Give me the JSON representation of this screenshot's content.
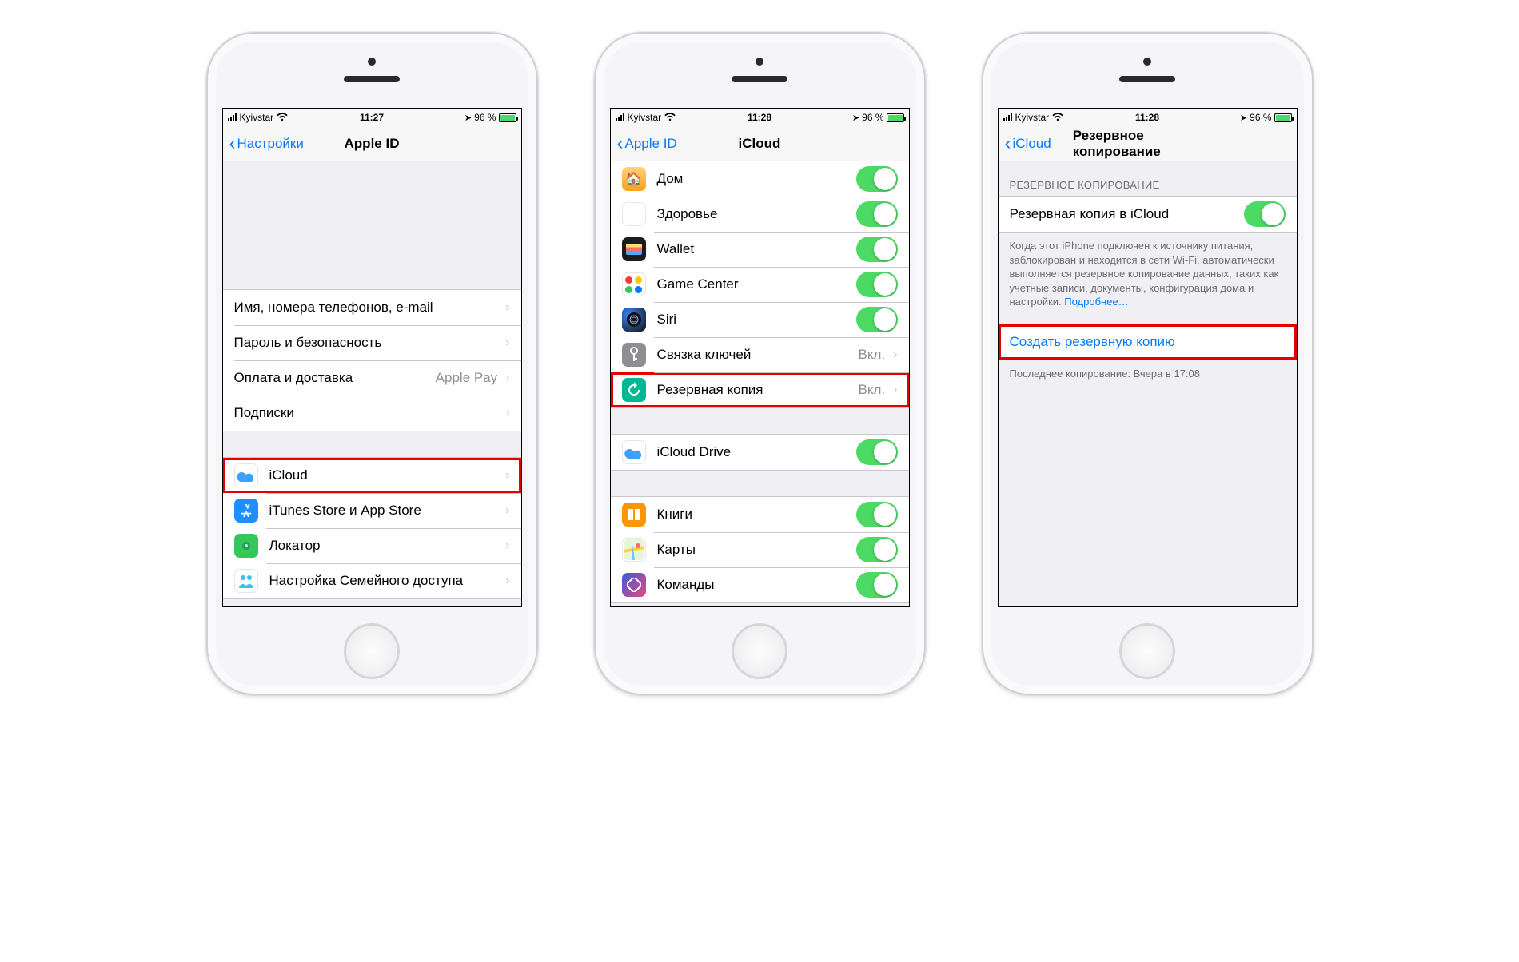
{
  "phone1": {
    "status": {
      "carrier": "Kyivstar",
      "time": "11:27",
      "battery": "96 %"
    },
    "nav": {
      "back": "Настройки",
      "title": "Apple ID"
    },
    "group1": [
      {
        "label": "Имя, номера телефонов, e-mail"
      },
      {
        "label": "Пароль и безопасность"
      },
      {
        "label": "Оплата и доставка",
        "detail": "Apple Pay"
      },
      {
        "label": "Подписки"
      }
    ],
    "group2": [
      {
        "label": "iCloud",
        "highlight": true,
        "icon": "icloud-icon"
      },
      {
        "label": "iTunes Store и App Store",
        "icon": "appstore-icon"
      },
      {
        "label": "Локатор",
        "icon": "findmy-icon"
      },
      {
        "label": "Настройка Семейного доступа",
        "icon": "family-icon"
      }
    ]
  },
  "phone2": {
    "status": {
      "carrier": "Kyivstar",
      "time": "11:28",
      "battery": "96 %"
    },
    "nav": {
      "back": "Apple ID",
      "title": "iCloud"
    },
    "groupA": [
      {
        "label": "Дом",
        "icon": "home-icon",
        "toggle": true
      },
      {
        "label": "Здоровье",
        "icon": "health-icon",
        "toggle": true
      },
      {
        "label": "Wallet",
        "icon": "wallet-icon",
        "toggle": true
      },
      {
        "label": "Game Center",
        "icon": "gamecenter-icon",
        "toggle": true
      },
      {
        "label": "Siri",
        "icon": "siri-icon",
        "toggle": true
      },
      {
        "label": "Связка ключей",
        "icon": "keychain-icon",
        "detail": "Вкл."
      },
      {
        "label": "Резервная копия",
        "icon": "backup-icon",
        "detail": "Вкл.",
        "highlight": true
      }
    ],
    "groupB": [
      {
        "label": "iCloud Drive",
        "icon": "iclouddrive-icon",
        "toggle": true
      }
    ],
    "groupC": [
      {
        "label": "Книги",
        "icon": "books-icon",
        "toggle": true
      },
      {
        "label": "Карты",
        "icon": "maps-icon",
        "toggle": true
      },
      {
        "label": "Команды",
        "icon": "shortcuts-icon",
        "toggle": true
      }
    ]
  },
  "phone3": {
    "status": {
      "carrier": "Kyivstar",
      "time": "11:28",
      "battery": "96 %"
    },
    "nav": {
      "back": "iCloud",
      "title": "Резервное копирование"
    },
    "section_header": "РЕЗЕРВНОЕ КОПИРОВАНИЕ",
    "toggle_row": {
      "label": "Резервная копия в iCloud"
    },
    "footer_text": "Когда этот iPhone подключен к источнику питания, заблокирован и находится в сети Wi-Fi, автоматически выполняется резервное копирование данных, таких как учетные записи, документы, конфигурация дома и настройки. ",
    "footer_link": "Подробнее…",
    "action_label": "Создать резервную копию",
    "last_backup": "Последнее копирование: Вчера в 17:08"
  }
}
